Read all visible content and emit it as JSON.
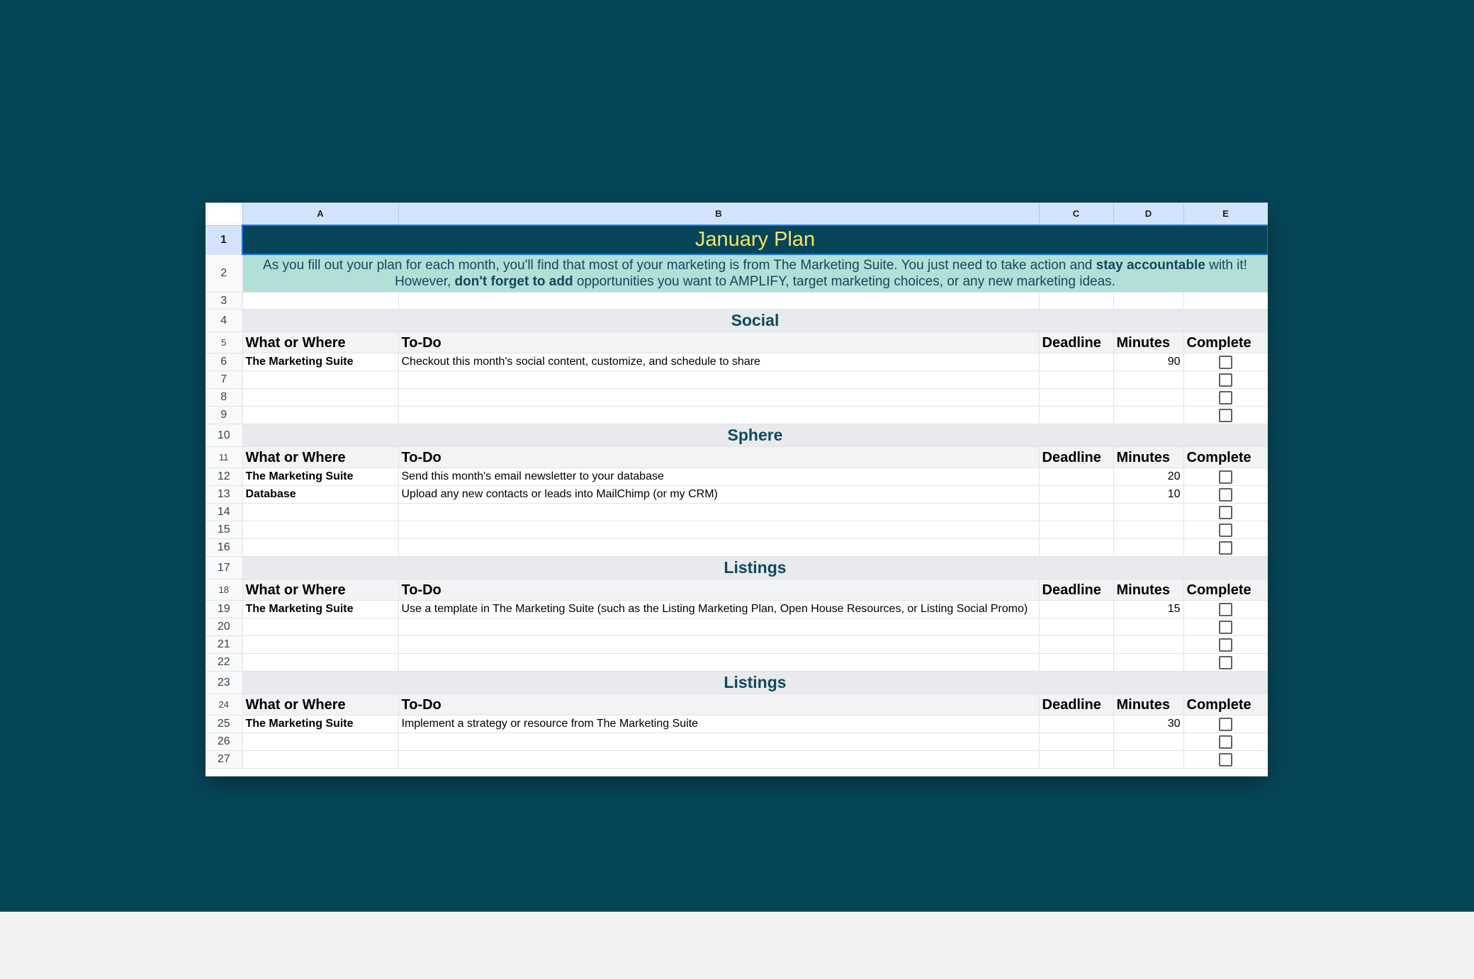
{
  "colors": {
    "backdrop": "#064658",
    "title_bg": "#064658",
    "title_text": "#f5e36b",
    "intro_bg": "#b3dfd9",
    "section_text": "#0e4a5c",
    "header_row_bg": "#d3e3fd"
  },
  "columns": [
    "A",
    "B",
    "C",
    "D",
    "E"
  ],
  "row_numbers": [
    "1",
    "2",
    "3",
    "4",
    "5",
    "6",
    "7",
    "8",
    "9",
    "10",
    "11",
    "12",
    "13",
    "14",
    "15",
    "16",
    "17",
    "18",
    "19",
    "20",
    "21",
    "22",
    "23",
    "24",
    "25",
    "26",
    "27"
  ],
  "title": "January Plan",
  "intro": {
    "line1_a": "As you fill out your plan for each month, you'll find that most of your marketing is from The Marketing Suite. You just need to take action and ",
    "line1_bold": "stay accountable",
    "line1_b": " with it!",
    "line2_a": "However, ",
    "line2_bold": "don't forget to add",
    "line2_b": " opportunities you want to AMPLIFY, target marketing choices, or any new marketing ideas."
  },
  "table_headers": {
    "what": "What or Where",
    "todo": "To-Do",
    "deadline": "Deadline",
    "minutes": "Minutes",
    "complete": "Complete"
  },
  "sections": [
    {
      "title": "Social",
      "rows": [
        {
          "what": "The Marketing Suite",
          "todo": "Checkout this month's social content, customize, and schedule to share",
          "deadline": "",
          "minutes": "90"
        },
        {
          "what": "",
          "todo": "",
          "deadline": "",
          "minutes": ""
        },
        {
          "what": "",
          "todo": "",
          "deadline": "",
          "minutes": ""
        },
        {
          "what": "",
          "todo": "",
          "deadline": "",
          "minutes": ""
        }
      ]
    },
    {
      "title": "Sphere",
      "rows": [
        {
          "what": "The Marketing Suite",
          "todo": "Send this month's email newsletter to your database",
          "deadline": "",
          "minutes": "20"
        },
        {
          "what": "Database",
          "todo": "Upload any new contacts or leads into MailChimp (or my CRM)",
          "deadline": "",
          "minutes": "10"
        },
        {
          "what": "",
          "todo": "",
          "deadline": "",
          "minutes": ""
        },
        {
          "what": "",
          "todo": "",
          "deadline": "",
          "minutes": ""
        },
        {
          "what": "",
          "todo": "",
          "deadline": "",
          "minutes": ""
        }
      ]
    },
    {
      "title": "Listings",
      "rows": [
        {
          "what": "The Marketing Suite",
          "todo": "Use a template in The Marketing Suite (such as the Listing Marketing Plan, Open House Resources, or Listing Social Promo)",
          "deadline": "",
          "minutes": "15"
        },
        {
          "what": "",
          "todo": "",
          "deadline": "",
          "minutes": ""
        },
        {
          "what": "",
          "todo": "",
          "deadline": "",
          "minutes": ""
        },
        {
          "what": "",
          "todo": "",
          "deadline": "",
          "minutes": ""
        }
      ]
    },
    {
      "title": "Listings",
      "rows": [
        {
          "what": "The Marketing Suite",
          "todo": "Implement a strategy or resource from The Marketing Suite",
          "deadline": "",
          "minutes": "30"
        },
        {
          "what": "",
          "todo": "",
          "deadline": "",
          "minutes": ""
        },
        {
          "what": "",
          "todo": "",
          "deadline": "",
          "minutes": ""
        }
      ]
    }
  ]
}
